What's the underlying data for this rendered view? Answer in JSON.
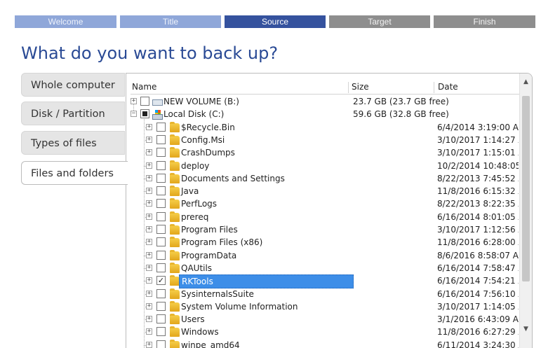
{
  "wizard_steps": [
    {
      "label": "Welcome",
      "state": "done"
    },
    {
      "label": "Title",
      "state": "done"
    },
    {
      "label": "Source",
      "state": "current"
    },
    {
      "label": "Target",
      "state": "todo"
    },
    {
      "label": "Finish",
      "state": "todo"
    }
  ],
  "heading": "What do you want to back up?",
  "tabs": [
    {
      "label": "Whole computer",
      "active": false
    },
    {
      "label": "Disk / Partition",
      "active": false
    },
    {
      "label": "Types of files",
      "active": false
    },
    {
      "label": "Files and folders",
      "active": true
    }
  ],
  "columns": {
    "name": "Name",
    "size": "Size",
    "date": "Date"
  },
  "drives": [
    {
      "name": "NEW VOLUME (B:)",
      "size": "23.7 GB (23.7 GB free)",
      "icon": "drive-icon",
      "checked": "none"
    },
    {
      "name": "Local Disk (C:)",
      "size": "59.6 GB (32.8 GB free)",
      "icon": "windows-disk-icon",
      "checked": "partial"
    }
  ],
  "folders": [
    {
      "name": "$Recycle.Bin",
      "date": "6/4/2014 3:19:00 AM",
      "checked": false
    },
    {
      "name": "Config.Msi",
      "date": "3/10/2017 1:14:27 A...",
      "checked": false
    },
    {
      "name": "CrashDumps",
      "date": "3/10/2017 1:15:01 A...",
      "checked": false
    },
    {
      "name": "deploy",
      "date": "10/2/2014 10:48:05 ...",
      "checked": false
    },
    {
      "name": "Documents and Settings",
      "date": "8/22/2013 7:45:52 A...",
      "checked": false
    },
    {
      "name": "Java",
      "date": "11/8/2016 6:15:32 A...",
      "checked": false
    },
    {
      "name": "PerfLogs",
      "date": "8/22/2013 8:22:35 A...",
      "checked": false
    },
    {
      "name": "prereq",
      "date": "6/16/2014 8:01:05 A...",
      "checked": false
    },
    {
      "name": "Program Files",
      "date": "3/10/2017 1:12:56 A...",
      "checked": false
    },
    {
      "name": "Program Files (x86)",
      "date": "11/8/2016 6:28:00 A...",
      "checked": false
    },
    {
      "name": "ProgramData",
      "date": "8/6/2016 8:58:07 AM",
      "checked": false
    },
    {
      "name": "QAUtils",
      "date": "6/16/2014 7:58:47 A...",
      "checked": false
    },
    {
      "name": "RKTools",
      "date": "6/16/2014 7:54:21 A...",
      "checked": true,
      "selected": true
    },
    {
      "name": "SysinternalsSuite",
      "date": "6/16/2014 7:56:10 A...",
      "checked": false
    },
    {
      "name": "System Volume Information",
      "date": "3/10/2017 1:14:05 A...",
      "checked": false
    },
    {
      "name": "Users",
      "date": "3/1/2016 6:43:09 AM",
      "checked": false
    },
    {
      "name": "Windows",
      "date": "11/8/2016 6:27:29 A...",
      "checked": false
    },
    {
      "name": "winpe_amd64",
      "date": "6/11/2014 3:24:30 A...",
      "checked": false
    }
  ],
  "glyphs": {
    "expand": "+",
    "collapse": "−",
    "check": "✓",
    "scroll_up": "▲",
    "scroll_down": "▼"
  },
  "colors": {
    "step_done": "#8fa7d9",
    "step_current": "#35529e",
    "step_todo": "#8e8e8e",
    "heading": "#2a4a95",
    "selection": "#3d8ee8"
  }
}
